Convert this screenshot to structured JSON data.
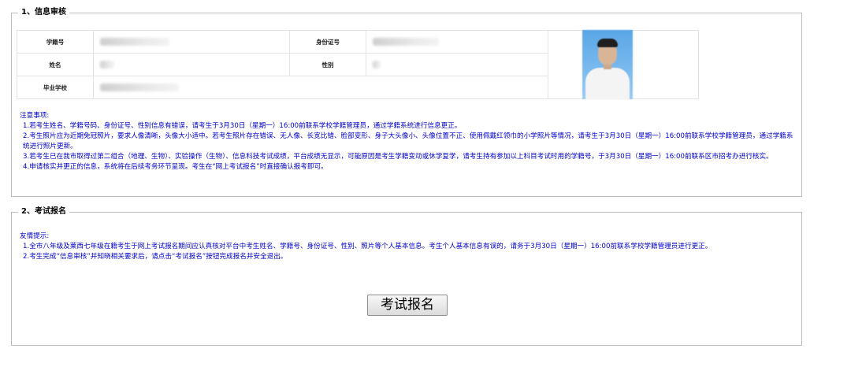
{
  "section1": {
    "legend": "1、信息审核",
    "labels": {
      "student_no": "学籍号",
      "id_no": "身份证号",
      "name": "姓名",
      "gender": "性别",
      "school": "毕业学校"
    },
    "notes_title": "注意事项:",
    "notes": [
      "1.若考生姓名、学籍号码、身份证号、性别信息有错误，请考生于3月30日（星期一）16:00前联系学校学籍管理员，通过学籍系统进行信息更正。",
      "2.考生照片应为近期免冠照片，要求人像清晰，头像大小适中。若考生照片存在错误、无人像、长宽比错、脸部变形、身子大头像小、头像位置不正、使用佩戴红领巾的小学照片等情况，请考生于3月30日（星期一）16:00前联系学校学籍管理员，通过学籍系统进行照片更新。",
      "3.若考生已在我市取得过第二组合（地理、生物）、实验操作（生物）、信息科技考试成绩，平台成绩无显示，可能原因是考生学籍变动或休学复学，请考生持有参加以上科目考试时用的学籍号，于3月30日（星期一）16:00前联系区市招考办进行核实。",
      "4.申请核实并更正的信息，系统将在后续考务环节呈现。考生在“网上考试报名”时直接确认报考即可。"
    ]
  },
  "section2": {
    "legend": "2、考试报名",
    "notes_title": "友情提示:",
    "notes": [
      "1.全市八年级及莱西七年级在籍考生于网上考试报名期间应认真核对平台中考生姓名、学籍号、身份证号、性别、照片等个人基本信息。考生个人基本信息有误的，请务于3月30日（星期一）16:00前联系学校学籍管理员进行更正。",
      "2.考生完成“信息审核”并知晓相关要求后，请点击“考试报名”按钮完成报名并安全退出。"
    ],
    "button_label": "考试报名"
  }
}
